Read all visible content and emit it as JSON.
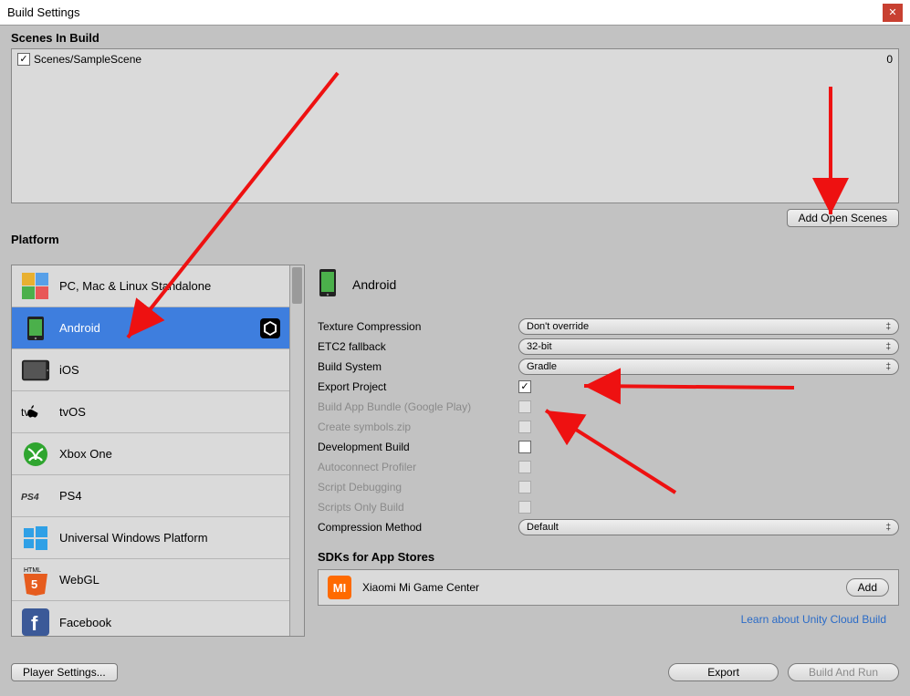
{
  "window": {
    "title": "Build Settings"
  },
  "scenes": {
    "label": "Scenes In Build",
    "rows": [
      {
        "name": "Scenes/SampleScene",
        "checked": true,
        "index": "0"
      }
    ],
    "add_open_label": "Add Open Scenes"
  },
  "platform": {
    "label": "Platform",
    "items": [
      {
        "label": "PC, Mac & Linux Standalone",
        "icon": "standalone"
      },
      {
        "label": "Android",
        "icon": "android",
        "selected": true,
        "unity_target": true
      },
      {
        "label": "iOS",
        "icon": "ios"
      },
      {
        "label": "tvOS",
        "icon": "tvos"
      },
      {
        "label": "Xbox One",
        "icon": "xbox"
      },
      {
        "label": "PS4",
        "icon": "ps4"
      },
      {
        "label": "Universal Windows Platform",
        "icon": "uwp"
      },
      {
        "label": "WebGL",
        "icon": "webgl"
      },
      {
        "label": "Facebook",
        "icon": "facebook"
      }
    ]
  },
  "config": {
    "header_label": "Android",
    "rows": {
      "texture_compression": {
        "label": "Texture Compression",
        "value": "Don't override",
        "type": "dropdown"
      },
      "etc2_fallback": {
        "label": "ETC2 fallback",
        "value": "32-bit",
        "type": "dropdown"
      },
      "build_system": {
        "label": "Build System",
        "value": "Gradle",
        "type": "dropdown"
      },
      "export_project": {
        "label": "Export Project",
        "checked": true,
        "type": "checkbox"
      },
      "build_app_bundle": {
        "label": "Build App Bundle (Google Play)",
        "checked": false,
        "disabled": true,
        "type": "checkbox"
      },
      "create_symbols": {
        "label": "Create symbols.zip",
        "checked": false,
        "disabled": true,
        "type": "checkbox"
      },
      "development_build": {
        "label": "Development Build",
        "checked": false,
        "type": "checkbox"
      },
      "autoconnect_profiler": {
        "label": "Autoconnect Profiler",
        "checked": false,
        "disabled": true,
        "type": "checkbox"
      },
      "script_debugging": {
        "label": "Script Debugging",
        "checked": false,
        "disabled": true,
        "type": "checkbox"
      },
      "scripts_only": {
        "label": "Scripts Only Build",
        "checked": false,
        "disabled": true,
        "type": "checkbox"
      },
      "compression_method": {
        "label": "Compression Method",
        "value": "Default",
        "type": "dropdown"
      }
    },
    "sdk_label": "SDKs for App Stores",
    "sdk_item": {
      "name": "Xiaomi Mi Game Center",
      "add_label": "Add"
    },
    "cloud_link": "Learn about Unity Cloud Build"
  },
  "bottom": {
    "player_settings": "Player Settings...",
    "export": "Export",
    "build_and_run": "Build And Run"
  }
}
